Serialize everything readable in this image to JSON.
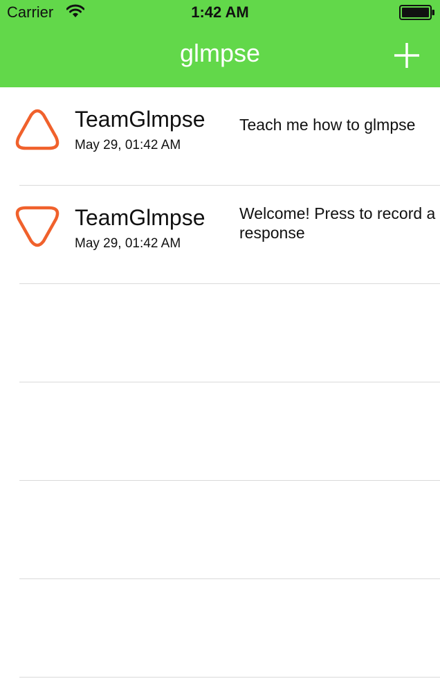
{
  "status_bar": {
    "carrier": "Carrier",
    "time": "1:42 AM",
    "wifi_icon": "wifi-icon",
    "battery_icon": "battery-full-icon"
  },
  "nav": {
    "title": "glmpse",
    "add_icon": "plus-icon"
  },
  "colors": {
    "header_bg": "#62d84a",
    "accent_orange": "#f0612c",
    "separator": "#d9d9d9"
  },
  "messages": [
    {
      "sender": "TeamGlmpse",
      "date": "May 29, 01:42 AM",
      "text": "Teach me how to glmpse",
      "icon": "triangle-up-icon"
    },
    {
      "sender": "TeamGlmpse",
      "date": "May 29, 01:42 AM",
      "text": "Welcome! Press to record a response",
      "icon": "triangle-down-icon"
    }
  ]
}
